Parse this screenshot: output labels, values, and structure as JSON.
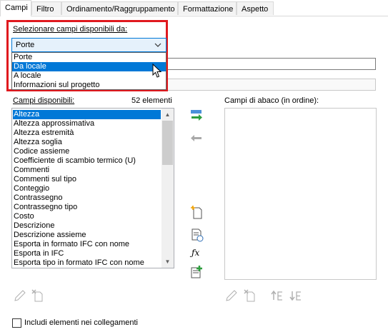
{
  "tabs": [
    "Campi",
    "Filtro",
    "Ordinamento/Raggruppamento",
    "Formattazione",
    "Aspetto"
  ],
  "fields_source": {
    "label": "Selezionare campi disponibili da:",
    "selected": "Porte",
    "options": [
      "Porte",
      "Da locale",
      "A locale",
      "Informazioni sul progetto"
    ]
  },
  "available": {
    "label": "Campi disponibili:",
    "count": "52 elementi",
    "items": [
      "Altezza",
      "Altezza approssimativa",
      "Altezza estremità",
      "Altezza soglia",
      "Codice assieme",
      "Coefficiente di scambio termico (U)",
      "Commenti",
      "Commenti sul tipo",
      "Conteggio",
      "Contrassegno",
      "Contrassegno tipo",
      "Costo",
      "Descrizione",
      "Descrizione assieme",
      "Esporta in formato IFC con nome",
      "Esporta in IFC",
      "Esporta tipo in formato IFC con nome"
    ]
  },
  "schedule": {
    "label": "Campi di abaco (in ordine):"
  },
  "include_links": {
    "label": "Includi elementi nei collegamenti",
    "checked": false
  },
  "colors": {
    "highlight": "#0078d7",
    "callout": "#e0191e"
  },
  "icons": [
    "add-parameter-icon",
    "remove-parameter-icon",
    "new-parameter-icon",
    "combine-parameters-icon",
    "calculated-value-icon",
    "add-project-parameter-icon",
    "edit-icon",
    "delete-icon",
    "move-up-icon",
    "move-down-icon",
    "chevron-down-icon",
    "mouse-cursor-icon"
  ]
}
